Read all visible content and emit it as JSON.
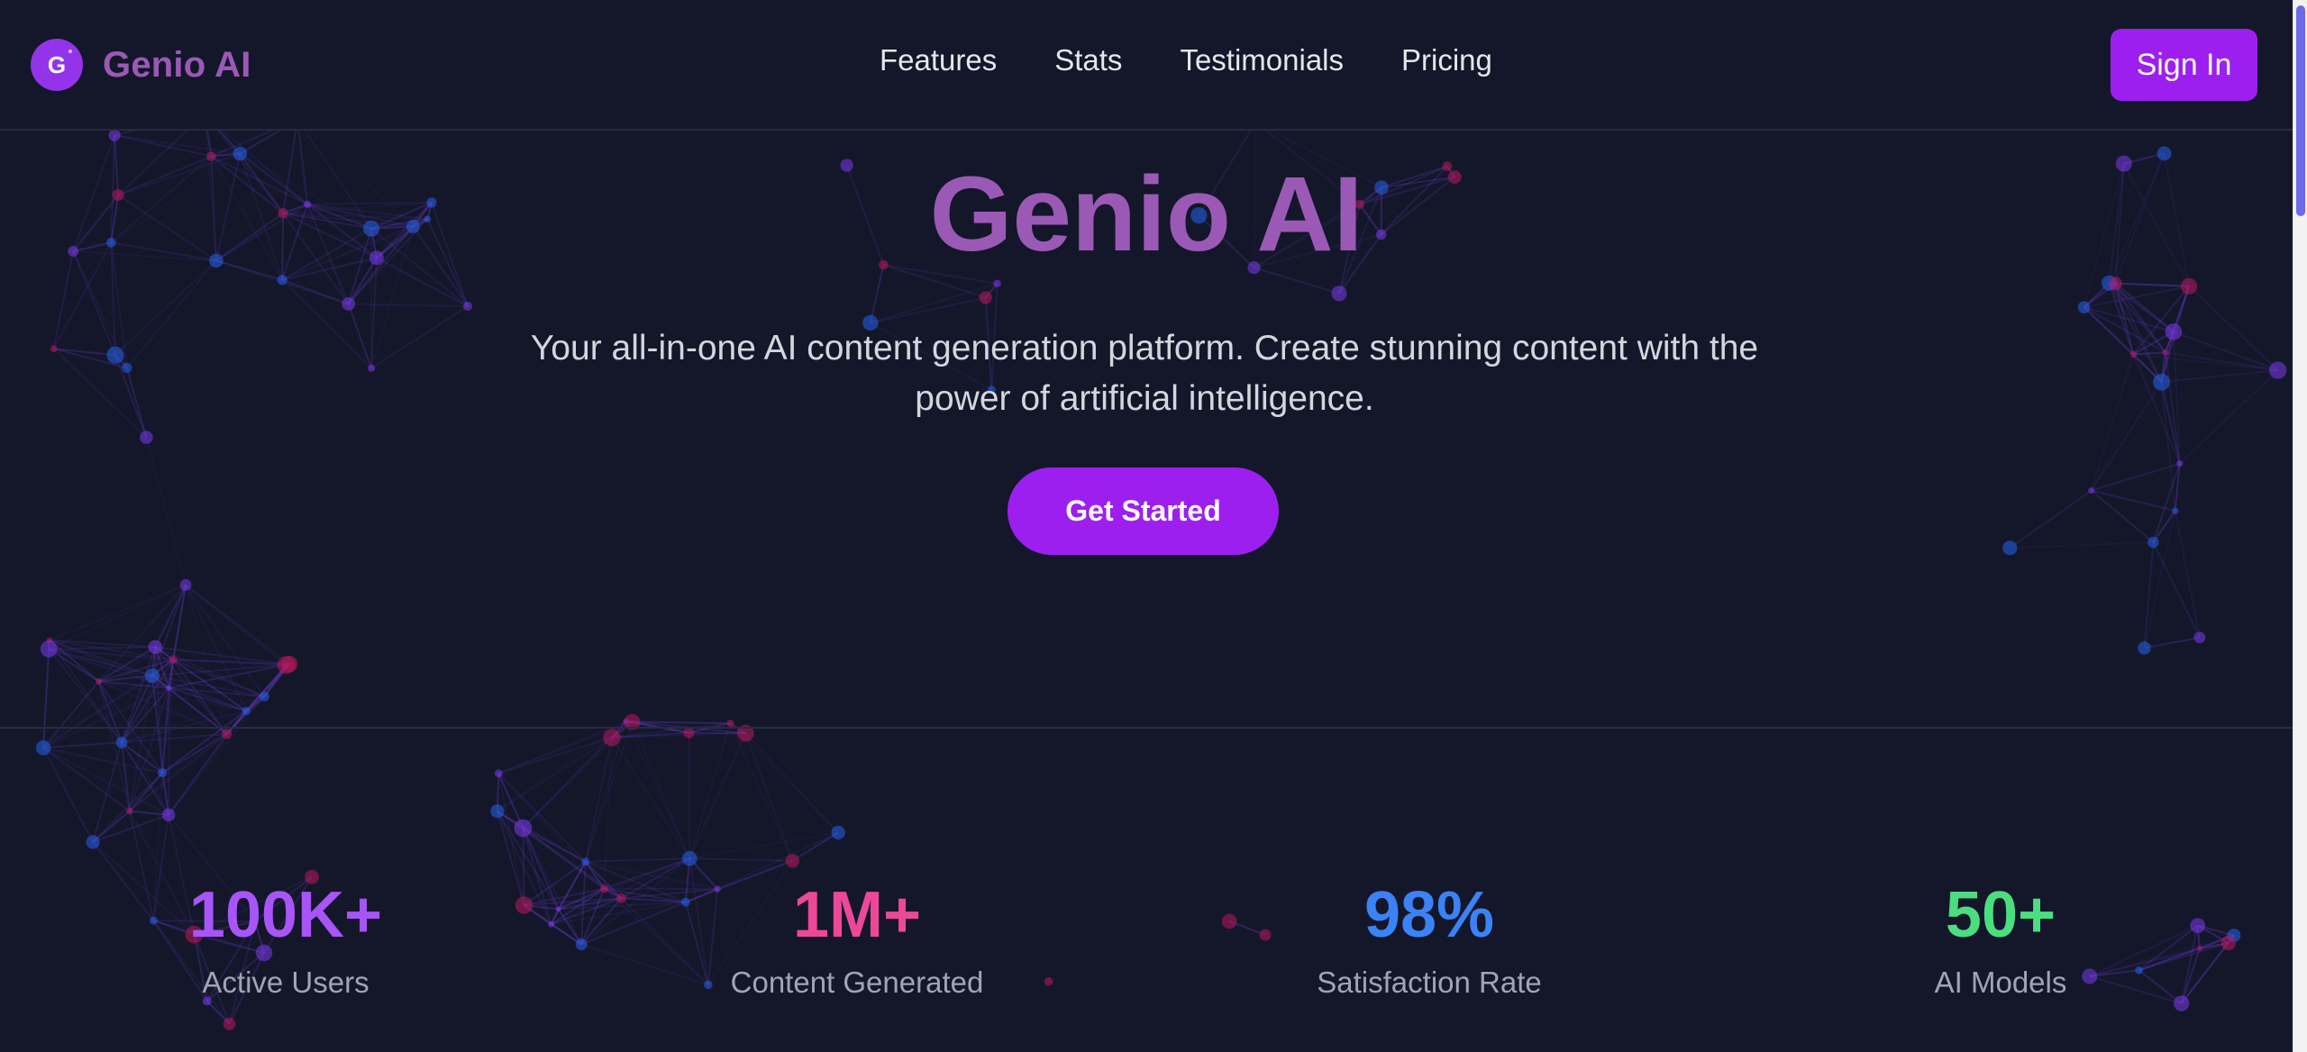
{
  "header": {
    "brand_name": "Genio AI",
    "logo_letter": "G",
    "nav": [
      {
        "label": "Features"
      },
      {
        "label": "Stats"
      },
      {
        "label": "Testimonials"
      },
      {
        "label": "Pricing"
      }
    ],
    "signin_label": "Sign In"
  },
  "hero": {
    "title": "Genio AI",
    "subtitle": "Your all-in-one AI content generation platform. Create stunning content with the power of artificial intelligence.",
    "cta_label": "Get Started"
  },
  "stats": [
    {
      "value": "100K+",
      "label": "Active Users",
      "color": "#a855f7"
    },
    {
      "value": "1M+",
      "label": "Content Generated",
      "color": "#ec4899"
    },
    {
      "value": "98%",
      "label": "Satisfaction Rate",
      "color": "#3b82f6"
    },
    {
      "value": "50+",
      "label": "AI Models",
      "color": "#4ade80"
    }
  ],
  "theme": {
    "background": "#131729",
    "accent": "#9d1fef",
    "brand": "#9b59b6",
    "node_colors": [
      "#7c3aed",
      "#2563eb",
      "#be185d"
    ]
  }
}
